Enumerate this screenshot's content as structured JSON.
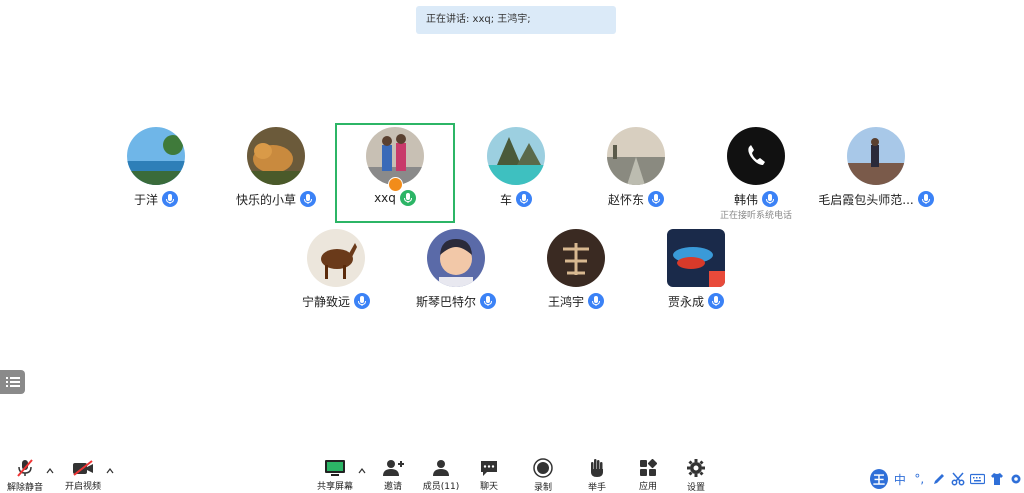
{
  "speaking_banner": "正在讲话: xxq; 王鸿宇;",
  "participants": [
    {
      "name": "于洋",
      "status": ""
    },
    {
      "name": "快乐的小草",
      "status": ""
    },
    {
      "name": "xxq",
      "status": ""
    },
    {
      "name": "车",
      "status": ""
    },
    {
      "name": "赵怀东",
      "status": ""
    },
    {
      "name": "韩伟",
      "status": "正在接听系统电话"
    },
    {
      "name": "毛启霞包头师范...",
      "status": ""
    },
    {
      "name": "宁静致远",
      "status": ""
    },
    {
      "name": "斯琴巴特尔",
      "status": ""
    },
    {
      "name": "王鸿宇",
      "status": ""
    },
    {
      "name": "贾永成",
      "status": ""
    }
  ],
  "toolbar": {
    "unmute": "解除静音",
    "start_video": "开启视频",
    "share_screen": "共享屏幕",
    "invite": "邀请",
    "members": "成员(11)",
    "chat": "聊天",
    "record": "录制",
    "raise_hand": "举手",
    "apps": "应用",
    "settings": "设置"
  },
  "ime": {
    "logo": "王",
    "mode": "中",
    "punct": "°,"
  },
  "colors": {
    "active_border": "#2cb566",
    "mic_blue": "#3b82f6",
    "mic_green": "#2cb566",
    "banner_bg": "#dbeaf8"
  }
}
